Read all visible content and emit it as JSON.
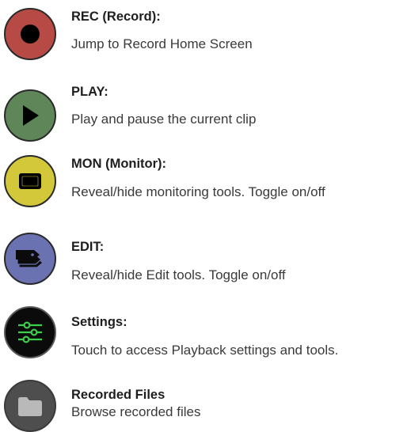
{
  "items": [
    {
      "title": "REC (Record):",
      "description": "Jump to Record Home Screen",
      "icon": "record-icon",
      "color": "#b84a45"
    },
    {
      "title": "PLAY:",
      "description": "Play and pause the current clip",
      "icon": "play-icon",
      "color": "#5e8658"
    },
    {
      "title": "MON (Monitor):",
      "description": "Reveal/hide monitoring tools. Toggle on/off",
      "icon": "monitor-icon",
      "color": "#d3c73a"
    },
    {
      "title": "EDIT:",
      "description": "Reveal/hide Edit tools. Toggle on/off",
      "icon": "edit-tags-icon",
      "color": "#6a72b2"
    },
    {
      "title": "Settings:",
      "description": "Touch to access Playback settings and tools.",
      "icon": "settings-sliders-icon",
      "color": "#0b0b0b",
      "accent": "#3ecf4a"
    },
    {
      "title": "Recorded Files",
      "description": "Browse recorded files",
      "icon": "folder-icon",
      "color": "#4e4e4e"
    }
  ]
}
